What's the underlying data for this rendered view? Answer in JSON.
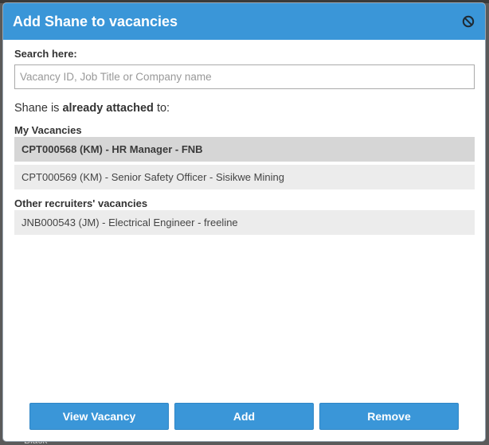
{
  "dialog": {
    "title": "Add Shane to vacancies",
    "close_icon": "ban-icon"
  },
  "search": {
    "label": "Search here:",
    "value": "",
    "placeholder": "Vacancy ID, Job Title or Company name"
  },
  "attached": {
    "prefix": "Shane is ",
    "emphasis": "already attached",
    "suffix": " to:"
  },
  "groups": {
    "my": {
      "label": "My Vacancies",
      "items": [
        {
          "text": "CPT000568 (KM) - HR Manager - FNB",
          "selected": true
        },
        {
          "text": "CPT000569 (KM) - Senior Safety Officer - Sisikwe Mining",
          "selected": false
        }
      ]
    },
    "other": {
      "label": "Other recruiters' vacancies",
      "items": [
        {
          "text": "JNB000543 (JM) - Electrical Engineer - freeline",
          "selected": false
        }
      ]
    }
  },
  "buttons": {
    "view": "View Vacancy",
    "add": "Add",
    "remove": "Remove"
  },
  "backdrop": {
    "peek_text": "Black"
  },
  "colors": {
    "header": "#3a96d8",
    "selected_row": "#d6d6d6",
    "row": "#ececec"
  }
}
